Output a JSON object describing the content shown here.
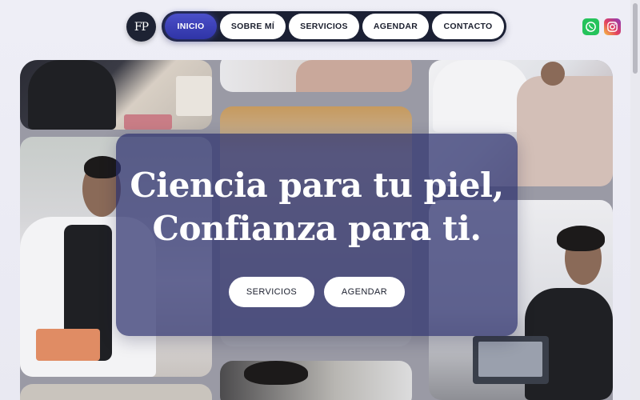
{
  "logo": {
    "text": "FP"
  },
  "nav": {
    "items": [
      {
        "label": "INICIO",
        "active": true
      },
      {
        "label": "SOBRE MÍ",
        "active": false
      },
      {
        "label": "SERVICIOS",
        "active": false
      },
      {
        "label": "AGENDAR",
        "active": false
      },
      {
        "label": "CONTACTO",
        "active": false
      }
    ]
  },
  "social": {
    "icons": [
      "whatsapp-icon",
      "instagram-icon"
    ]
  },
  "hero": {
    "headline_line1": "Ciencia para tu piel,",
    "headline_line2": "Confianza para ti.",
    "buttons": [
      {
        "label": "SERVICIOS"
      },
      {
        "label": "AGENDAR"
      }
    ]
  },
  "colors": {
    "nav_background": "#1b2034",
    "nav_active": "#3d42b8",
    "overlay": "#2d306e",
    "whatsapp": "#25c35b"
  }
}
